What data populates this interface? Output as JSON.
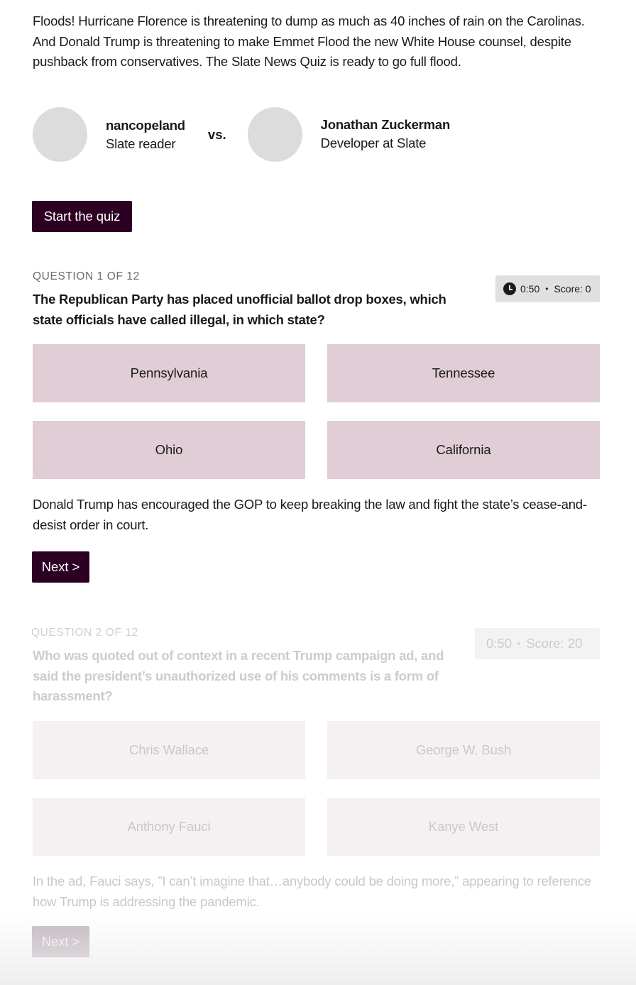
{
  "intro": "Floods! Hurricane Florence is threatening to dump as much as 40 inches of rain on the Carolinas. And Donald Trump is threatening to make Emmet Flood the new White House counsel, despite pushback from conservatives. The Slate News Quiz is ready to go full flood.",
  "players": {
    "player1": {
      "name": "nancopeland",
      "role": "Slate reader"
    },
    "vs": "vs.",
    "player2": {
      "name": "Jonathan Zuckerman",
      "role": "Developer at Slate"
    }
  },
  "start_button": "Start the quiz",
  "colors": {
    "primary_button": "#2d0023",
    "answer_bg": "#e1cdd6",
    "timer_bg": "#e0e0e0",
    "avatar_placeholder": "#dcdcdc"
  },
  "questions": [
    {
      "label": "QUESTION 1 OF 12",
      "text": "The Republican Party has placed unofficial ballot drop boxes, which state officials have called illegal, in which state?",
      "timer": {
        "icon": "clock-icon",
        "time": "0:50",
        "separator": "•",
        "score": "Score: 0"
      },
      "answers": [
        "Pennsylvania",
        "Tennessee",
        "Ohio",
        "California"
      ],
      "explanation": "Donald Trump has encouraged the GOP to keep breaking the law and fight the state’s cease-and-desist order in court.",
      "next_button": "Next >"
    },
    {
      "label": "QUESTION 2 OF 12",
      "text": "Who was quoted out of context in a recent Trump campaign ad, and said the president’s unauthorized use of his comments is a form of harassment?",
      "timer": {
        "time": "0:50",
        "separator": "•",
        "score": "Score: 20"
      },
      "answers": [
        "Chris Wallace",
        "George W. Bush",
        "Anthony Fauci",
        "Kanye West"
      ],
      "explanation": "In the ad, Fauci says, ”I can’t imagine that…anybody could be doing more,” appearing to reference how Trump is addressing the pandemic.",
      "next_button": "Next >"
    }
  ]
}
